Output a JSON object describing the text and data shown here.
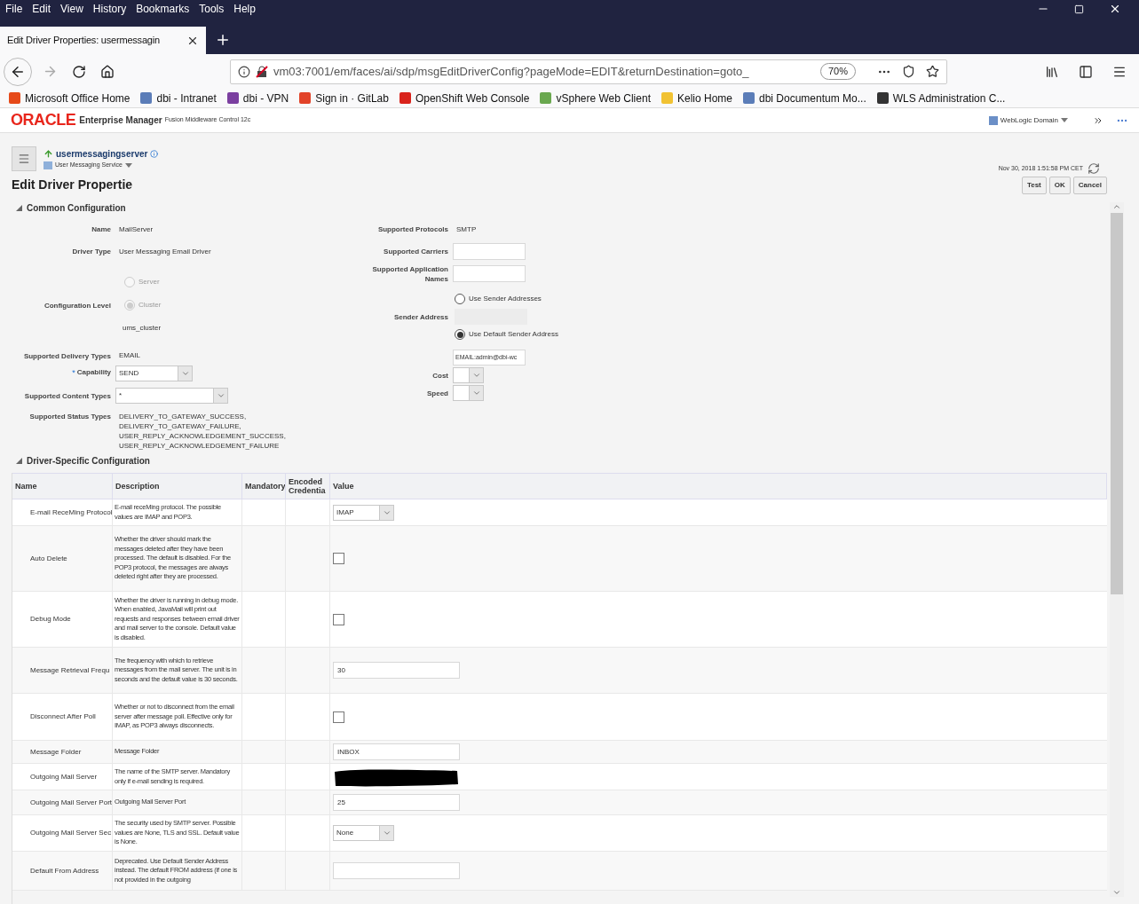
{
  "browser": {
    "menu": [
      "File",
      "Edit",
      "View",
      "History",
      "Bookmarks",
      "Tools",
      "Help"
    ],
    "tab": {
      "title": "Edit Driver Properties: usermessagin",
      "selected": true
    },
    "url": "vm03:7001/em/faces/ai/sdp/msgEditDriverConfig?pageMode=EDIT&returnDestination=goto_",
    "zoom": "70%",
    "bookmarks": [
      {
        "label": "Microsoft Office Home",
        "color": "#e64a19"
      },
      {
        "label": "dbi - Intranet",
        "color": "#5b7db8"
      },
      {
        "label": "dbi - VPN",
        "color": "#7b3fa0"
      },
      {
        "label": "Sign in · GitLab",
        "color": "#e24329"
      },
      {
        "label": "OpenShift Web Console",
        "color": "#d9231b"
      },
      {
        "label": "vSphere Web Client",
        "color": "#6aa84f"
      },
      {
        "label": "Kelio Home",
        "color": "#f1c232"
      },
      {
        "label": "dbi Documentum Mo...",
        "color": "#5b7db8"
      },
      {
        "label": "WLS Administration C...",
        "color": "#333333"
      }
    ]
  },
  "em_header": {
    "logo": "ORACLE",
    "product": "Enterprise Manager",
    "subtitle": "Fusion Middleware Control 12c",
    "domain_menu": "WebLogic Domain"
  },
  "target": {
    "name": "usermessagingserver",
    "type": "User Messaging Service",
    "timestamp": "Nov 30, 2018 1:51:58 PM CET"
  },
  "page_title": "Edit Driver Propertie",
  "buttons": [
    "Test",
    "OK",
    "Cancel"
  ],
  "common": {
    "title": "Common Configuration",
    "expanded": true,
    "name": {
      "label": "Name",
      "value": "MailServer"
    },
    "driver_type": {
      "label": "Driver Type",
      "value": "User Messaging Email Driver"
    },
    "config_level": {
      "label": "Configuration Level",
      "options": [
        {
          "label": "Server",
          "selected": false
        },
        {
          "label": "Cluster",
          "selected": true
        }
      ],
      "cluster": "ums_cluster"
    },
    "delivery_types": {
      "label": "Supported Delivery Types",
      "value": "EMAIL"
    },
    "capability": {
      "label": "Capability",
      "required_mark": "*",
      "value": "SEND"
    },
    "content_types": {
      "label": "Supported Content Types",
      "value": "*"
    },
    "status_types": {
      "label": "Supported Status Types",
      "lines": [
        "DELIVERY_TO_GATEWAY_SUCCESS,",
        "DELIVERY_TO_GATEWAY_FAILURE,",
        "USER_REPLY_ACKNOWLEDGEMENT_SUCCESS,",
        "USER_REPLY_ACKNOWLEDGEMENT_FAILURE"
      ]
    },
    "protocols": {
      "label": "Supported Protocols",
      "value": "SMTP"
    },
    "carriers": {
      "label": "Supported Carriers"
    },
    "app_names": {
      "label": "Supported Application Names"
    },
    "sender": {
      "label": "Sender Address",
      "options": [
        {
          "label": "Use Sender Addresses",
          "selected": false
        },
        {
          "label": "Use Default Sender Address",
          "selected": true
        }
      ],
      "default_value": "EMAIL:admin@dbi-wc"
    },
    "cost": {
      "label": "Cost"
    },
    "speed": {
      "label": "Speed"
    }
  },
  "driver_config": {
    "title": "Driver-Specific Configuration",
    "expanded": true,
    "columns": [
      "Name",
      "Description",
      "Mandatory",
      "Encoded Credentia",
      "Value"
    ],
    "rows": [
      {
        "name": "E-mail ReceMing Protocol",
        "description": "E-mail receMing protocol. The possible values are IMAP and POP3.",
        "kind": "select",
        "value": "IMAP"
      },
      {
        "name": "Auto Delete",
        "description": "Whether the driver should mark the messages deleted after they have been processed. The default is disabled. For the POP3 protocol, the messages are always deleted right after they are processed.",
        "kind": "checkbox",
        "checked": false
      },
      {
        "name": "Debug Mode",
        "description": "Whether the driver is running in debug mode. When enabled, JavaMail will print out requests and responses between email driver and mail server to the console. Default value is disabled.",
        "kind": "checkbox",
        "checked": false
      },
      {
        "name": "Message Retrieval Frequ",
        "description": "The frequency with which to retrieve messages from the mail server. The unit is in seconds and the default value is 30 seconds.",
        "kind": "text",
        "value": "30"
      },
      {
        "name": "Disconnect After Poll",
        "description": "Whether or not to disconnect from the email server after message poll. Effective only for IMAP, as POP3 always disconnects.",
        "kind": "checkbox",
        "checked": false
      },
      {
        "name": "Message Folder",
        "description": "Message Folder",
        "kind": "text",
        "value": "INBOX"
      },
      {
        "name": "Outgoing Mail Server",
        "description": "The name of the SMTP server. Mandatory only if e-mail sending is required.",
        "kind": "redacted"
      },
      {
        "name": "Outgoing Mail Server Port",
        "description": "Outgoing Mail Server Port",
        "kind": "text",
        "value": "25"
      },
      {
        "name": "Outgoing Mail Server Sec",
        "description": "The security used by SMTP server. Possible values are None, TLS and SSL. Default value is None.",
        "kind": "select",
        "value": "None"
      },
      {
        "name": "Default From Address",
        "description": "Deprecated. Use Default Sender Address instead. The default FROM address (if one is not provided in the outgoing",
        "kind": "text"
      }
    ]
  }
}
